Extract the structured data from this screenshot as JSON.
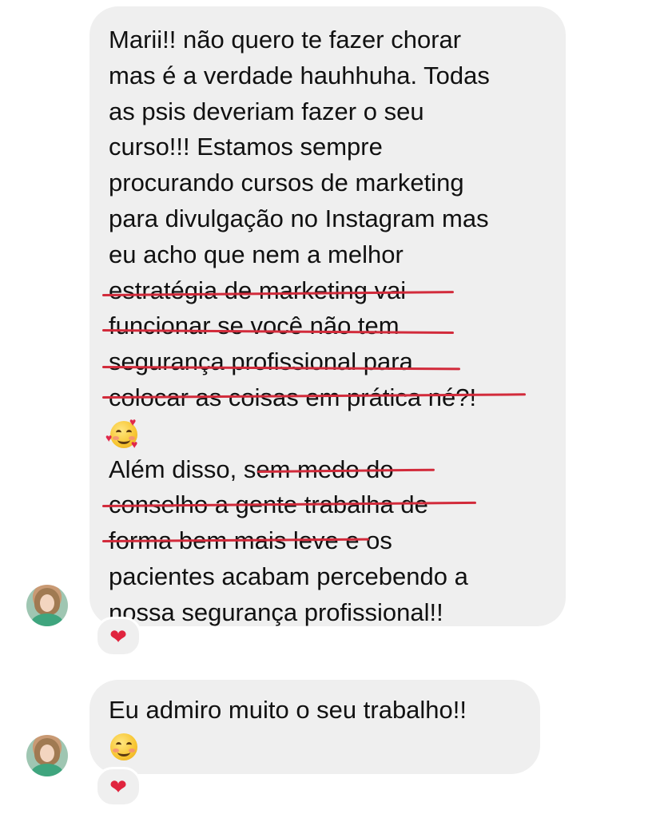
{
  "messages": [
    {
      "lines": [
        "Marii!! não quero te fazer chorar",
        "mas é a verdade hauhhuha. Todas",
        "as psis deveriam fazer o seu",
        "curso!!! Estamos sempre",
        "procurando cursos de marketing",
        "para divulgação no Instagram mas",
        "eu acho que nem a melhor",
        "estratégia de marketing vai",
        "funcionar se você não tem",
        "segurança profissional para",
        "colocar as coisas em prática né?!"
      ],
      "emoji": "smiling-face-with-hearts",
      "lines2": [
        "Além disso, sem medo do",
        "conselho a gente trabalha de",
        "forma bem mais leve e os",
        "pacientes acabam percebendo a",
        "nossa segurança profissional!!"
      ],
      "reaction": "❤"
    },
    {
      "lines": [
        "Eu admiro muito o seu trabalho!!"
      ],
      "emoji": "smiling-face",
      "reaction": "❤"
    }
  ],
  "colors": {
    "bubble": "#efefef",
    "text": "#111111",
    "underline": "#d22b3b",
    "heart": "#e0243e"
  },
  "icons": {
    "avatar": "profile-photo",
    "reaction": "red-heart-icon"
  }
}
